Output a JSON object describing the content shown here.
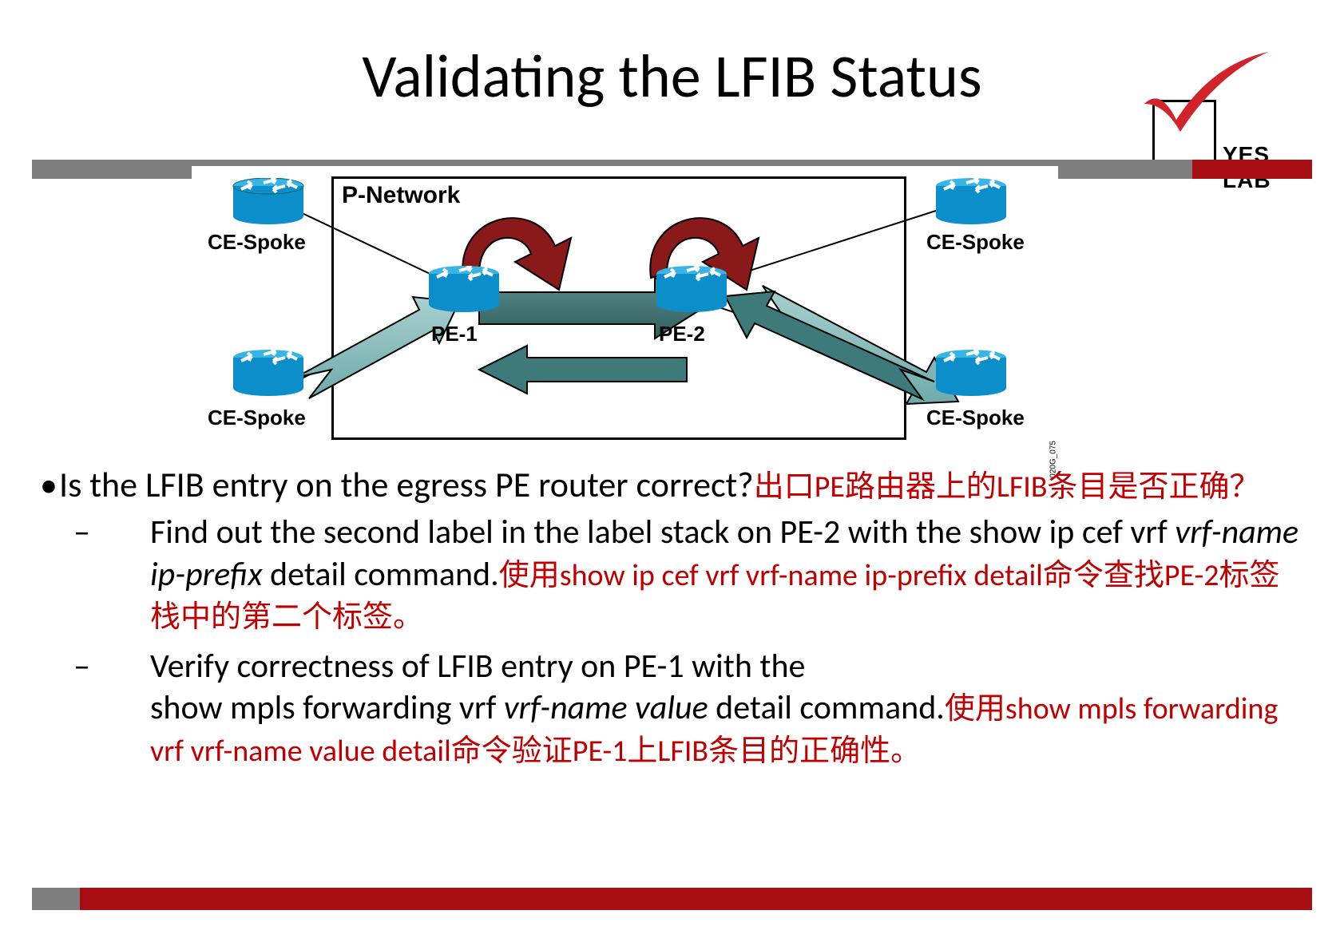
{
  "title": "Validating the LFIB Status",
  "logo": {
    "text": "YES LAB"
  },
  "diagram": {
    "box_label": "P-Network",
    "watermark": "020G_075",
    "routers": {
      "topleft": {
        "label": "CE-Spoke"
      },
      "botleft": {
        "label": "CE-Spoke"
      },
      "topright": {
        "label": "CE-Spoke"
      },
      "botright": {
        "label": "CE-Spoke"
      },
      "pe1": {
        "label": "PE-1"
      },
      "pe2": {
        "label": "PE-2"
      }
    }
  },
  "bullet1": {
    "en": "Is the LFIB entry on the egress PE router correct?",
    "zh": "出口PE路由器上的LFIB条目是否正确？"
  },
  "sub1": {
    "en_a": "Find out the second label in the label stack on PE-2 with the  show ip cef vrf ",
    "en_ital": "vrf-name ip-prefix",
    "en_b": " detail command.",
    "zh": "使用show ip cef vrf vrf-name ip-prefix detail命令查找PE-2标签栈中的第二个标签。"
  },
  "sub2": {
    "en_a": "Verify correctness of LFIB entry on PE-1 with the",
    "en_b": "show mpls forwarding vrf ",
    "en_ital": "vrf-name value",
    "en_c": " detail command.",
    "zh": "使用show mpls forwarding vrf vrf-name value detail命令验证PE-1上LFIB条目的正确性。"
  }
}
